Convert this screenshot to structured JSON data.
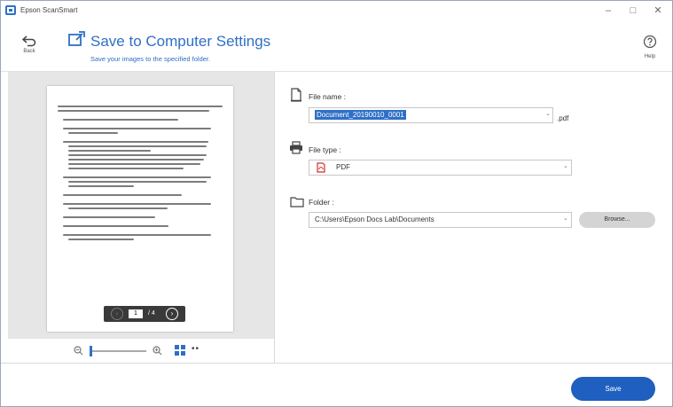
{
  "window": {
    "app_title": "Epson ScanSmart",
    "minimize": "–",
    "maximize": "□",
    "close": "✕"
  },
  "header": {
    "back_label": "Back",
    "title": "Save to Computer Settings",
    "subtitle": "Save your images to the specified folder.",
    "help_label": "Help"
  },
  "preview": {
    "page_current": "1",
    "page_total": "/ 4",
    "prev_icon": "‹",
    "next_icon": "›",
    "more": "••"
  },
  "settings": {
    "file_name_label": "File name :",
    "file_name_value": "Document_20190010_0001",
    "file_ext": ".pdf",
    "file_type_label": "File type :",
    "file_type_value": "PDF",
    "folder_label": "Folder :",
    "folder_value": "C:\\Users\\Epson Docs Lab\\Documents",
    "browse_label": "Browse...",
    "dropdown_arrow": "⌄"
  },
  "footer": {
    "save_label": "Save"
  },
  "colors": {
    "accent": "#2f6fc6",
    "save_button": "#1f5fbf",
    "pdf_icon": "#d32f2f"
  }
}
